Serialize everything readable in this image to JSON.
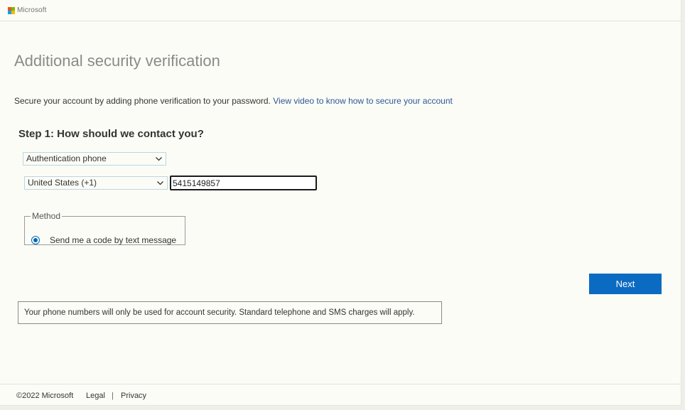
{
  "brand": {
    "name": "Microsoft",
    "logo_colors": [
      "#f25022",
      "#7fba00",
      "#00a4ef",
      "#ffb900"
    ]
  },
  "page": {
    "title": "Additional security verification",
    "subtitle": "Secure your account by adding phone verification to your password.",
    "subtitle_link": "View video to know how to secure your account"
  },
  "step1": {
    "title": "Step 1: How should we contact you?",
    "contact_method": "Authentication phone",
    "country": "United States (+1)",
    "phone_number": "5415149857"
  },
  "method": {
    "legend": "Method",
    "option_label": "Send me a code by text message",
    "option_selected": true
  },
  "next_button": "Next",
  "notice": "Your phone numbers will only be used for account security. Standard telephone and SMS charges will apply.",
  "footer": {
    "copyright": "©2022 Microsoft",
    "legal": "Legal",
    "separator": "|",
    "privacy": "Privacy"
  },
  "colors": {
    "accent": "#0b6bc2",
    "link": "#2b5797"
  }
}
